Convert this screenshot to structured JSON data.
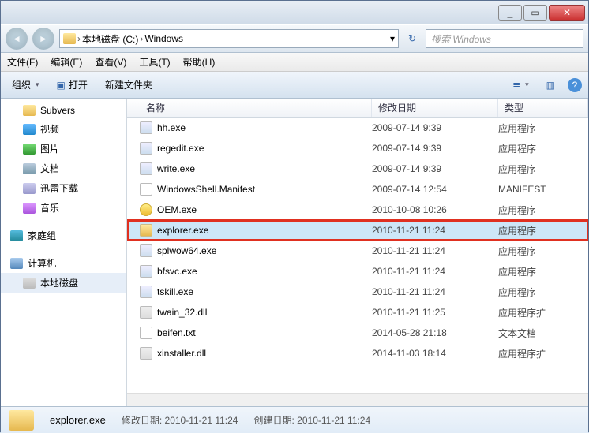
{
  "titlebar": {
    "min": "_",
    "max": "▭",
    "close": "✕"
  },
  "nav": {
    "back": "◄",
    "fwd": "►",
    "crumbs": [
      "本地磁盘 (C:)",
      "Windows"
    ],
    "sep": "›",
    "dropdown": "▾",
    "refresh": "↻",
    "search_placeholder": "搜索 Windows"
  },
  "menu": {
    "file": "文件(F)",
    "edit": "编辑(E)",
    "view": "查看(V)",
    "tools": "工具(T)",
    "help": "帮助(H)"
  },
  "toolbar": {
    "organize": "组织",
    "open": "打开",
    "newfolder": "新建文件夹",
    "view_ico": "≣",
    "preview_ico": "▥",
    "help_ico": "?"
  },
  "sidebar": {
    "items": [
      {
        "label": "Subvers",
        "ico": "ico-folder"
      },
      {
        "label": "视频",
        "ico": "ico-video"
      },
      {
        "label": "图片",
        "ico": "ico-pic"
      },
      {
        "label": "文档",
        "ico": "ico-doc"
      },
      {
        "label": "迅雷下载",
        "ico": "ico-dl"
      },
      {
        "label": "音乐",
        "ico": "ico-music"
      }
    ],
    "homegroup": "家庭组",
    "computer": "计算机",
    "drive": "本地磁盘"
  },
  "columns": {
    "name": "名称",
    "date": "修改日期",
    "type": "类型"
  },
  "files": [
    {
      "name": "hh.exe",
      "date": "2009-07-14 9:39",
      "type": "应用程序",
      "ico": "exe"
    },
    {
      "name": "regedit.exe",
      "date": "2009-07-14 9:39",
      "type": "应用程序",
      "ico": "exe"
    },
    {
      "name": "write.exe",
      "date": "2009-07-14 9:39",
      "type": "应用程序",
      "ico": "exe"
    },
    {
      "name": "WindowsShell.Manifest",
      "date": "2009-07-14 12:54",
      "type": "MANIFEST",
      "ico": "man"
    },
    {
      "name": "OEM.exe",
      "date": "2010-10-08 10:26",
      "type": "应用程序",
      "ico": "yel"
    },
    {
      "name": "explorer.exe",
      "date": "2010-11-21 11:24",
      "type": "应用程序",
      "ico": "fold",
      "hl": true
    },
    {
      "name": "splwow64.exe",
      "date": "2010-11-21 11:24",
      "type": "应用程序",
      "ico": "exe"
    },
    {
      "name": "bfsvc.exe",
      "date": "2010-11-21 11:24",
      "type": "应用程序",
      "ico": "exe"
    },
    {
      "name": "tskill.exe",
      "date": "2010-11-21 11:24",
      "type": "应用程序",
      "ico": "exe"
    },
    {
      "name": "twain_32.dll",
      "date": "2010-11-21 11:25",
      "type": "应用程序扩",
      "ico": "dll"
    },
    {
      "name": "beifen.txt",
      "date": "2014-05-28 21:18",
      "type": "文本文档",
      "ico": "txt"
    },
    {
      "name": "xinstaller.dll",
      "date": "2014-11-03 18:14",
      "type": "应用程序扩",
      "ico": "dll"
    }
  ],
  "status": {
    "name": "explorer.exe",
    "mod_label": "修改日期:",
    "mod_value": "2010-11-21 11:24",
    "create_label": "创建日期:",
    "create_value": "2010-11-21 11:24"
  }
}
